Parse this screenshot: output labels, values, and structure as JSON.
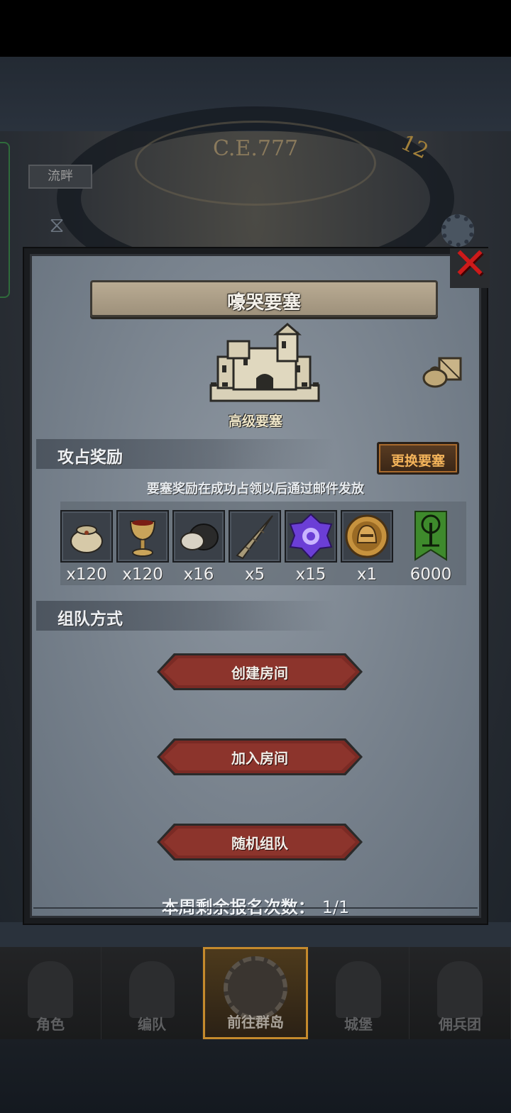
{
  "background": {
    "era_label": "C.E.777",
    "left_tab": "流畔",
    "clock_number": "12"
  },
  "dialog": {
    "title": "嚎哭要塞",
    "close_icon": "close-icon",
    "fortress_level": "高级要塞",
    "bag_icon": "supplies-bag-icon",
    "rewards_section": {
      "title": "攻占奖励",
      "change_button": "更换要塞",
      "note": "要塞奖励在成功占领以后通过邮件发放",
      "items": [
        {
          "icon": "sack-icon",
          "qty": "x120"
        },
        {
          "icon": "goblet-icon",
          "qty": "x120"
        },
        {
          "icon": "ore-icon",
          "qty": "x16"
        },
        {
          "icon": "horn-icon",
          "qty": "x5"
        },
        {
          "icon": "purple-crystal-icon",
          "qty": "x15"
        },
        {
          "icon": "helmet-medal-icon",
          "qty": "x1"
        },
        {
          "icon": "green-banner-icon",
          "qty": "6000"
        }
      ]
    },
    "team_section": {
      "title": "组队方式",
      "create_room": "创建房间",
      "join_room": "加入房间",
      "random_team": "随机组队"
    },
    "signup_label": "本周剩余报名次数：",
    "signup_count": "1/1"
  },
  "bottom_nav": [
    {
      "label": "角色",
      "icon": "knight-icon",
      "active": false
    },
    {
      "label": "编队",
      "icon": "helmet-icon",
      "active": false
    },
    {
      "label": "前往群岛",
      "icon": "compass-icon",
      "active": true
    },
    {
      "label": "城堡",
      "icon": "castle-icon",
      "active": false
    },
    {
      "label": "佣兵团",
      "icon": "ship-icon",
      "active": false
    }
  ],
  "colors": {
    "close_red": "#cc1a1a",
    "button_red": "#7a2a24",
    "accent_orange": "#f3b35a",
    "active_nav_border": "#c58a2c"
  }
}
